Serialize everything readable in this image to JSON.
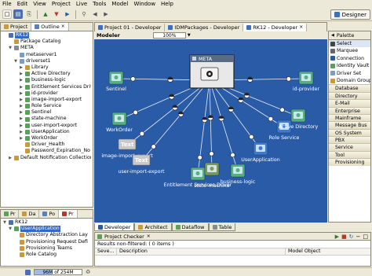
{
  "menu": [
    "File",
    "Edit",
    "View",
    "Project",
    "Live",
    "Tools",
    "Model",
    "Window",
    "Help"
  ],
  "perspective_label": "Designer",
  "left_top": {
    "tabs": [
      "Project",
      "Outline"
    ],
    "tree": [
      {
        "indent": 0,
        "twisty": "",
        "label": "RK12",
        "selected": true,
        "color": "#4b6fb5"
      },
      {
        "indent": 1,
        "twisty": "",
        "label": "Package Catalog",
        "color": "#c89a3a"
      },
      {
        "indent": 1,
        "twisty": "▼",
        "label": "META",
        "color": "#8a8a8a"
      },
      {
        "indent": 2,
        "twisty": "",
        "label": "metaserver1",
        "color": "#7a9cc6"
      },
      {
        "indent": 2,
        "twisty": "▼",
        "label": "driverset1",
        "color": "#7a9cc6"
      },
      {
        "indent": 3,
        "twisty": "▶",
        "label": "Library",
        "color": "#c89a3a"
      },
      {
        "indent": 3,
        "twisty": "▶",
        "label": "Active Directory",
        "color": "#5aa05a"
      },
      {
        "indent": 3,
        "twisty": "▶",
        "label": "business-logic",
        "color": "#5aa05a"
      },
      {
        "indent": 3,
        "twisty": "▶",
        "label": "Entitlement Services Drive",
        "color": "#5aa05a"
      },
      {
        "indent": 3,
        "twisty": "▶",
        "label": "id-provider",
        "color": "#5aa05a"
      },
      {
        "indent": 3,
        "twisty": "▶",
        "label": "image-import-export",
        "color": "#5aa05a"
      },
      {
        "indent": 3,
        "twisty": "▶",
        "label": "Role Service",
        "color": "#5aa05a"
      },
      {
        "indent": 3,
        "twisty": "▶",
        "label": "Sentinel",
        "color": "#5aa05a"
      },
      {
        "indent": 3,
        "twisty": "▶",
        "label": "state-machine",
        "color": "#5aa05a"
      },
      {
        "indent": 3,
        "twisty": "▶",
        "label": "user-import-export",
        "color": "#5aa05a"
      },
      {
        "indent": 3,
        "twisty": "▶",
        "label": "UserApplication",
        "color": "#5aa05a"
      },
      {
        "indent": 3,
        "twisty": "▶",
        "label": "WorkOrder",
        "color": "#5aa05a"
      },
      {
        "indent": 3,
        "twisty": "",
        "label": "Driver_Health",
        "color": "#c89a3a"
      },
      {
        "indent": 3,
        "twisty": "",
        "label": "Password_Expiration_No",
        "color": "#c89a3a"
      },
      {
        "indent": 1,
        "twisty": "▶",
        "label": "Default Notification Collection",
        "color": "#c89a3a"
      }
    ]
  },
  "left_bottom": {
    "tabs": [
      "Pr",
      "Da",
      "Po",
      "Pr"
    ],
    "tree": [
      {
        "indent": 0,
        "twisty": "▼",
        "label": "RK12",
        "color": "#4b6fb5"
      },
      {
        "indent": 1,
        "twisty": "▼",
        "label": "UserApplication",
        "selected": true,
        "color": "#5aa05a"
      },
      {
        "indent": 2,
        "twisty": "",
        "label": "Directory Abstraction Lay",
        "color": "#c89a3a"
      },
      {
        "indent": 2,
        "twisty": "",
        "label": "Provisioning Request Defi",
        "color": "#c89a3a"
      },
      {
        "indent": 2,
        "twisty": "",
        "label": "Provisioning Teams",
        "color": "#c89a3a"
      },
      {
        "indent": 2,
        "twisty": "",
        "label": "Role Catalog",
        "color": "#c89a3a"
      }
    ]
  },
  "editor_tabs": [
    "Project 01 - Developer",
    "IDMPackages - Developer",
    "RK12 - Developer"
  ],
  "modeler": {
    "label": "Modeler",
    "zoom": "100%"
  },
  "diagram": {
    "center": {
      "label": "META"
    },
    "nodes": [
      {
        "id": "sentinel",
        "label": "Sentinel",
        "kind": "green"
      },
      {
        "id": "workorder",
        "label": "WorkOrder",
        "kind": "green"
      },
      {
        "id": "image",
        "label": "image-import-export",
        "kind": "text"
      },
      {
        "id": "userimp",
        "label": "user-import-export",
        "kind": "text"
      },
      {
        "id": "ent",
        "label": "Entitlement Services Driver",
        "kind": "green"
      },
      {
        "id": "state",
        "label": "state-machine",
        "kind": "photo"
      },
      {
        "id": "bl",
        "label": "business-logic",
        "kind": "green"
      },
      {
        "id": "ua",
        "label": "UserApplication",
        "kind": "blue"
      },
      {
        "id": "role",
        "label": "Role Service",
        "kind": "blue"
      },
      {
        "id": "ad",
        "label": "Active Directory",
        "kind": "green"
      },
      {
        "id": "idp",
        "label": "id-provider",
        "kind": "green"
      }
    ],
    "text_icon_label": "Text"
  },
  "palette": {
    "title": "Palette",
    "tools": [
      "Select",
      "Marquee",
      "Connection",
      "Identity Vault",
      "Driver Set",
      "Domain Group"
    ],
    "drawers": [
      "Database",
      "Directory",
      "E-Mail",
      "Enterprise",
      "Mainframe",
      "Message Bus",
      "OS System",
      "PBX",
      "Service",
      "Tool",
      "Provisioning"
    ]
  },
  "bottom_tabs": [
    "Developer",
    "Architect",
    "Dataflow",
    "Table"
  ],
  "checker": {
    "title": "Project Checker",
    "summary": "Results non-filtered: ( 0 items )",
    "columns": [
      "Seve...",
      "Description",
      "Model Object"
    ]
  },
  "status": {
    "memory": "96M of 254M"
  },
  "colors": {
    "canvas": "#2a5ba7",
    "selection": "#316ac5"
  }
}
